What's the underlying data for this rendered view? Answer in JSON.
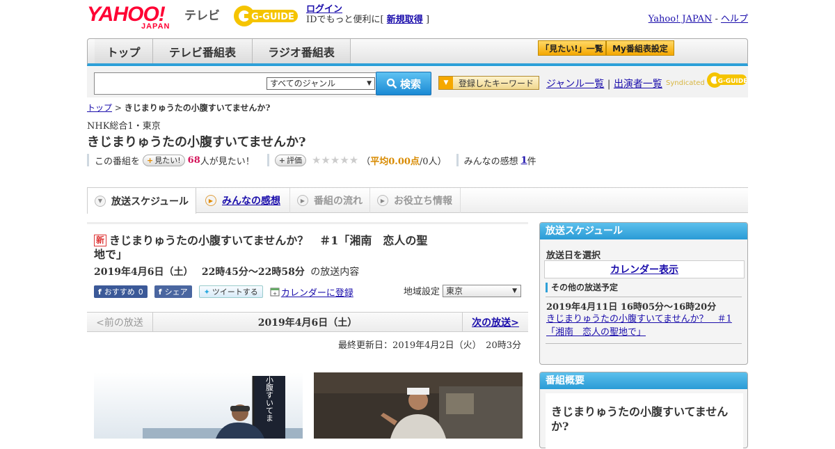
{
  "header": {
    "logo_main": "YAHOO!",
    "logo_sub": "JAPAN",
    "tv_label": "テレビ",
    "gguide_label": "G-GUIDE",
    "login_link": "ログイン",
    "login_text": "IDでもっと便利に[",
    "signup_link": "新規取得",
    "login_close": "]",
    "yahoo_japan_link": "Yahoo! JAPAN",
    "separator": "-",
    "help_link": "ヘルプ"
  },
  "nav": {
    "tabs": [
      {
        "label": "トップ"
      },
      {
        "label": "テレビ番組表"
      },
      {
        "label": "ラジオ番組表"
      }
    ],
    "mitai_list": "「見たい!」一覧",
    "my_bangumi": "My番組表設定"
  },
  "search": {
    "input_value": "",
    "genre_selected": "すべてのジャンル",
    "search_button": "検索",
    "keyword_button": "登録したキーワード",
    "genre_list_link": "ジャンル一覧",
    "link_separator": "|",
    "performer_list_link": "出演者一覧",
    "syndicated_label": "Syndicated"
  },
  "breadcrumb": {
    "top_link": "トップ",
    "separator": ">",
    "current": "きじまりゅうたの小腹すいてませんか?"
  },
  "program": {
    "channel": "NHK総合1・東京",
    "title": "きじまりゅうたの小腹すいてませんか?",
    "mitai_prefix": "この番組を",
    "mitai_button": "見たい!",
    "mitai_count": "68",
    "mitai_suffix": "人が見たい！",
    "hyouka_button": "評価",
    "stars": "★★★★★",
    "avg_open": "（",
    "avg_label": "平均0.00点",
    "avg_people": "/0人）",
    "kansou_label": "みんなの感想",
    "kansou_count": "1",
    "kansou_suffix": "件"
  },
  "tabs": [
    {
      "label": "放送スケジュール"
    },
    {
      "label": "みんなの感想"
    },
    {
      "label": "番組の流れ"
    },
    {
      "label": "お役立ち情報"
    }
  ],
  "episode": {
    "new_badge": "新",
    "title": "きじまりゅうたの小腹すいてませんか？　＃1「湘南　恋人の聖地で」",
    "date": "2019年4月6日（土）",
    "time": "22時45分～22時58分",
    "date_suffix": "の放送内容",
    "share_recommend": "おすすめ",
    "share_recommend_count": "0",
    "share_fb": "シェア",
    "share_tweet": "ツイートする",
    "calendar_link": "カレンダーに登録",
    "region_label": "地域設定",
    "region_selected": "東京"
  },
  "pager": {
    "prev": "<前の放送",
    "current": "2019年4月6日（土）",
    "next": "次の放送>"
  },
  "updated": "最終更新日：2019年4月2日（火）　20時3分",
  "sidebar": {
    "schedule_header": "放送スケジュール",
    "select_date_label": "放送日を選択",
    "calendar_button": "カレンダー表示",
    "other_label": "その他の放送予定",
    "other_date": "2019年4月11日  16時05分～16時20分",
    "other_link": "きじまりゅうたの小腹すいてませんか？　＃1「湘南　恋人の聖地で」",
    "summary_header": "番組概要",
    "summary_title": "きじまりゅうたの小腹すいてませんか?"
  },
  "photo": {
    "banner_text": "小腹すいてま"
  },
  "colors": {
    "accent_blue": "#2ea0d8",
    "link": "#1a0dab",
    "yahoo_red": "#ff0033",
    "button_orange": "#f5a800"
  }
}
